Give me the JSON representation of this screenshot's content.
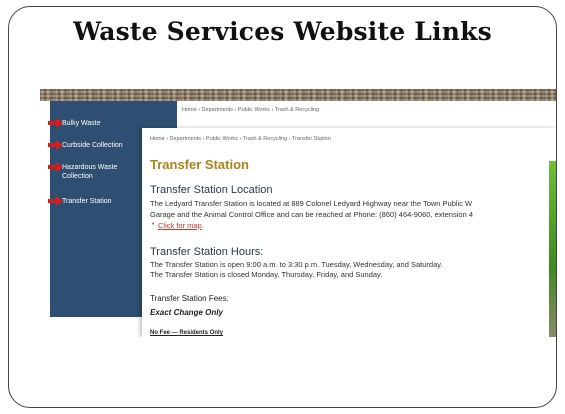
{
  "slide": {
    "title": "Waste Services Website Links"
  },
  "website": {
    "back_breadcrumb": "Home › Departments › Public Works › Trash & Recycling",
    "sidebar": {
      "items": [
        {
          "label": "Bulky Waste",
          "arrow": true
        },
        {
          "label": "Curbside Collection",
          "arrow": true
        },
        {
          "label": "Hazardous Waste Collection",
          "arrow": true
        },
        {
          "label": "Transfer Station",
          "arrow": true
        }
      ]
    },
    "page": {
      "breadcrumb": "Home › Departments › Public Works › Trash & Recycling › Transfer Station",
      "heading": "Transfer Station",
      "location_heading": "Transfer Station Location",
      "location_line1": "The Ledyard Transfer Station is located at 889 Colonel Ledyard Highway near the Town Public W",
      "location_line2": "Garage and the Animal Control Office and can be reached at Phone: (860) 464-9060, extension 4",
      "map_link": "Click for map",
      "hours_heading": "Transfer Station Hours:",
      "hours_line1": "The Transfer Station is open 9:00 a.m. to 3:30 p.m. Tuesday, Wednesday, and Saturday.",
      "hours_line2": "The Transfer Station is closed Monday, Thursday, Friday, and Sunday.",
      "fees_label": "Transfer Station Fees:",
      "fees_value": "Exact Change Only",
      "fee_note": "No Fee — Residents Only"
    }
  },
  "colors": {
    "sidebar_bg": "#2e4f72",
    "heading": "#a8841a",
    "arrow": "#d41e1e",
    "link": "#c0392b"
  }
}
